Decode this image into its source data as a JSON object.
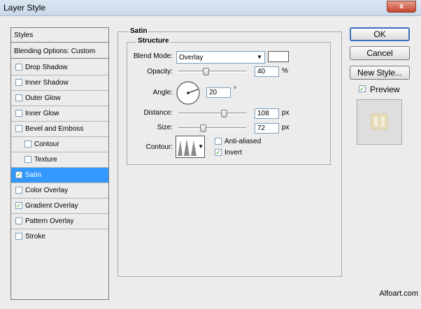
{
  "window": {
    "title": "Layer Style",
    "close": "x"
  },
  "styles": {
    "header": "Styles",
    "blending": "Blending Options: Custom",
    "items": [
      {
        "label": "Drop Shadow",
        "checked": false
      },
      {
        "label": "Inner Shadow",
        "checked": false
      },
      {
        "label": "Outer Glow",
        "checked": false
      },
      {
        "label": "Inner Glow",
        "checked": false
      },
      {
        "label": "Bevel and Emboss",
        "checked": false
      },
      {
        "label": "Contour",
        "checked": false
      },
      {
        "label": "Texture",
        "checked": false
      },
      {
        "label": "Satin",
        "checked": true
      },
      {
        "label": "Color Overlay",
        "checked": false
      },
      {
        "label": "Gradient Overlay",
        "checked": true
      },
      {
        "label": "Pattern Overlay",
        "checked": false
      },
      {
        "label": "Stroke",
        "checked": false
      }
    ]
  },
  "satin": {
    "title": "Satin",
    "structure": "Structure",
    "blend_mode_label": "Blend Mode:",
    "blend_mode": "Overlay",
    "blend_color": "#ffffff",
    "opacity_label": "Opacity:",
    "opacity": "40",
    "opacity_unit": "%",
    "angle_label": "Angle:",
    "angle": "20",
    "angle_unit": "°",
    "distance_label": "Distance:",
    "distance": "108",
    "distance_unit": "px",
    "size_label": "Size:",
    "size": "72",
    "size_unit": "px",
    "contour_label": "Contour:",
    "anti_aliased_label": "Anti-aliased",
    "anti_aliased": false,
    "invert_label": "Invert",
    "invert": true
  },
  "buttons": {
    "ok": "OK",
    "cancel": "Cancel",
    "new_style": "New Style...",
    "preview_label": "Preview",
    "preview": true
  },
  "watermark": "Alfoart.com"
}
